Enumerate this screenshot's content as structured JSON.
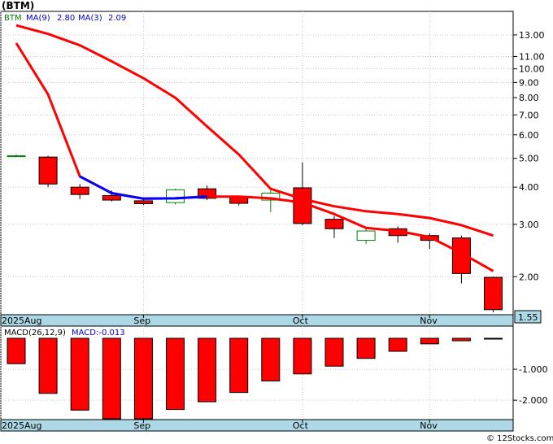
{
  "chart_data": [
    {
      "type": "candlestick",
      "title": "(BTM)",
      "ticker_label": "BTM",
      "scale": "log",
      "ylim": [
        1.5,
        15.5
      ],
      "y_ticks": [
        "13.00",
        "11.00",
        "10.00",
        "9.00",
        "8.00",
        "7.00",
        "6.00",
        "5.00",
        "4.00",
        "3.00",
        "2.00"
      ],
      "y_tick_values": [
        13,
        11,
        10,
        9,
        8,
        7,
        6,
        5,
        4,
        3,
        2
      ],
      "last_price_label": "1.55",
      "last_price": 1.55,
      "x_labels": [
        "2025Aug",
        "Sep",
        "Oct",
        "Nov"
      ],
      "grid": true,
      "legend": [
        {
          "label": "BTM",
          "color": "#008000"
        },
        {
          "label": "MA(9)",
          "value": "2.80",
          "color": "#0000cc"
        },
        {
          "label": "MA(3)",
          "value": "2.09",
          "color": "#0000cc"
        }
      ],
      "candles": [
        {
          "open": 5.1,
          "high": 5.15,
          "low": 5.05,
          "close": 5.1
        },
        {
          "open": 5.05,
          "high": 5.1,
          "low": 4.0,
          "close": 4.1
        },
        {
          "open": 4.0,
          "high": 4.1,
          "low": 3.65,
          "close": 3.78
        },
        {
          "open": 3.75,
          "high": 3.9,
          "low": 3.58,
          "close": 3.62
        },
        {
          "open": 3.6,
          "high": 3.65,
          "low": 3.48,
          "close": 3.52
        },
        {
          "open": 3.55,
          "high": 3.95,
          "low": 3.5,
          "close": 3.92
        },
        {
          "open": 3.95,
          "high": 4.05,
          "low": 3.62,
          "close": 3.67
        },
        {
          "open": 3.7,
          "high": 3.75,
          "low": 3.47,
          "close": 3.53
        },
        {
          "open": 3.62,
          "high": 3.95,
          "low": 3.3,
          "close": 3.82
        },
        {
          "open": 3.98,
          "high": 4.85,
          "low": 2.98,
          "close": 3.02
        },
        {
          "open": 3.12,
          "high": 3.2,
          "low": 2.7,
          "close": 2.9
        },
        {
          "open": 2.65,
          "high": 2.9,
          "low": 2.58,
          "close": 2.85
        },
        {
          "open": 2.9,
          "high": 2.95,
          "low": 2.6,
          "close": 2.75
        },
        {
          "open": 2.75,
          "high": 2.8,
          "low": 2.48,
          "close": 2.65
        },
        {
          "open": 2.7,
          "high": 2.75,
          "low": 1.9,
          "close": 2.05
        },
        {
          "open": 1.99,
          "high": 2.0,
          "low": 1.52,
          "close": 1.55
        }
      ],
      "ma9": [
        {
          "i": 0,
          "v": 14.0
        },
        {
          "i": 1,
          "v": 13.1
        },
        {
          "i": 2,
          "v": 12.0
        },
        {
          "i": 3,
          "v": 10.6
        },
        {
          "i": 4,
          "v": 9.3
        },
        {
          "i": 5,
          "v": 8.0
        },
        {
          "i": 6,
          "v": 6.4
        },
        {
          "i": 7,
          "v": 5.15
        },
        {
          "i": 8,
          "v": 3.95
        },
        {
          "i": 9,
          "v": 3.65
        },
        {
          "i": 10,
          "v": 3.45
        },
        {
          "i": 11,
          "v": 3.32
        },
        {
          "i": 12,
          "v": 3.25
        },
        {
          "i": 13,
          "v": 3.15
        },
        {
          "i": 14,
          "v": 2.98
        },
        {
          "i": 15,
          "v": 2.75
        }
      ],
      "ma3": [
        {
          "i": 0,
          "v": 12.2
        },
        {
          "i": 1,
          "v": 8.2
        },
        {
          "i": 2,
          "v": 4.35
        },
        {
          "i": 3,
          "v": 3.82
        },
        {
          "i": 4,
          "v": 3.66
        },
        {
          "i": 5,
          "v": 3.67
        },
        {
          "i": 6,
          "v": 3.72
        },
        {
          "i": 7,
          "v": 3.72
        },
        {
          "i": 8,
          "v": 3.67
        },
        {
          "i": 9,
          "v": 3.55
        },
        {
          "i": 10,
          "v": 3.25
        },
        {
          "i": 11,
          "v": 2.92
        },
        {
          "i": 12,
          "v": 2.85
        },
        {
          "i": 13,
          "v": 2.72
        },
        {
          "i": 14,
          "v": 2.4
        },
        {
          "i": 15,
          "v": 2.09
        }
      ],
      "ma3_highlight": [
        4,
        6
      ]
    },
    {
      "type": "bar",
      "title": "MACD(26,12,9)",
      "legend": [
        {
          "label": "MACD(26,12,9)",
          "color": "#000000"
        },
        {
          "label": "MACD:-0.013",
          "color": "#0000cc"
        }
      ],
      "ylim": [
        -2.6,
        0.0
      ],
      "y_ticks": [
        "-1.000",
        "-2.000"
      ],
      "y_tick_values": [
        -1.0,
        -2.0
      ],
      "x_labels": [
        "2025Aug",
        "Sep",
        "Oct",
        "Nov"
      ],
      "values": [
        -0.82,
        -1.78,
        -2.32,
        -2.6,
        -2.6,
        -2.3,
        -2.05,
        -1.75,
        -1.38,
        -1.15,
        -0.9,
        -0.65,
        -0.42,
        -0.18,
        -0.08,
        -0.013
      ]
    }
  ],
  "colors": {
    "up_fill": "#ffffff",
    "up_border": "#008000",
    "down_fill": "#ff0000",
    "down_border": "#000000",
    "ma_line": "#ff0000",
    "ma_highlight": "#0000ff",
    "grid": "#c8c8c8",
    "axis_strip": "#add8e6",
    "price_box": "#add8e6"
  },
  "footer": "© 12Stocks.com"
}
